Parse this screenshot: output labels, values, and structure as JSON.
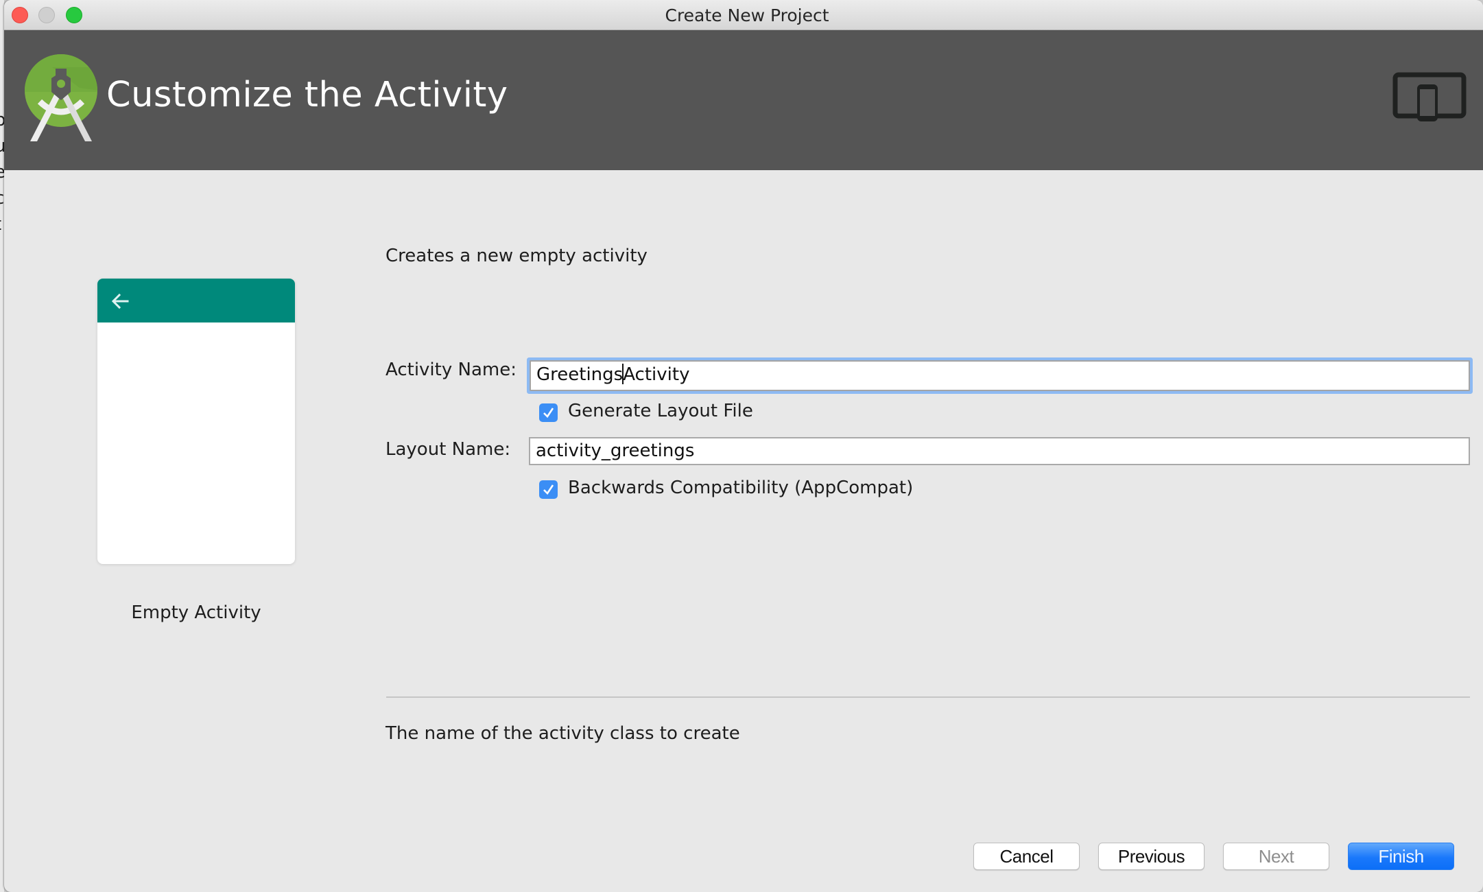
{
  "background_fragments": [
    "p",
    "u",
    "e",
    "c",
    "t"
  ],
  "window": {
    "title": "Create New Project"
  },
  "header": {
    "title": "Customize the Activity",
    "logo": "android-studio-logo-icon",
    "device_icon": "tablet-phone-icon"
  },
  "preview": {
    "label": "Empty Activity",
    "back_icon": "arrow-left-icon",
    "toolbar_color": "#00897b"
  },
  "form": {
    "description": "Creates a new empty activity",
    "activity_name": {
      "label": "Activity Name:",
      "value_before_caret": "Greetings",
      "value_after_caret": "Activity",
      "value": "GreetingsActivity"
    },
    "generate_layout": {
      "label": "Generate Layout File",
      "checked": true
    },
    "layout_name": {
      "label": "Layout Name:",
      "value": "activity_greetings"
    },
    "backwards_compat": {
      "label": "Backwards Compatibility (AppCompat)",
      "checked": true
    },
    "help_text": "The name of the activity class to create"
  },
  "buttons": {
    "cancel": "Cancel",
    "previous": "Previous",
    "next": "Next",
    "finish": "Finish"
  },
  "colors": {
    "header_bg": "#555555",
    "accent": "#3b8ef5",
    "primary_button": "#1a78fb"
  }
}
